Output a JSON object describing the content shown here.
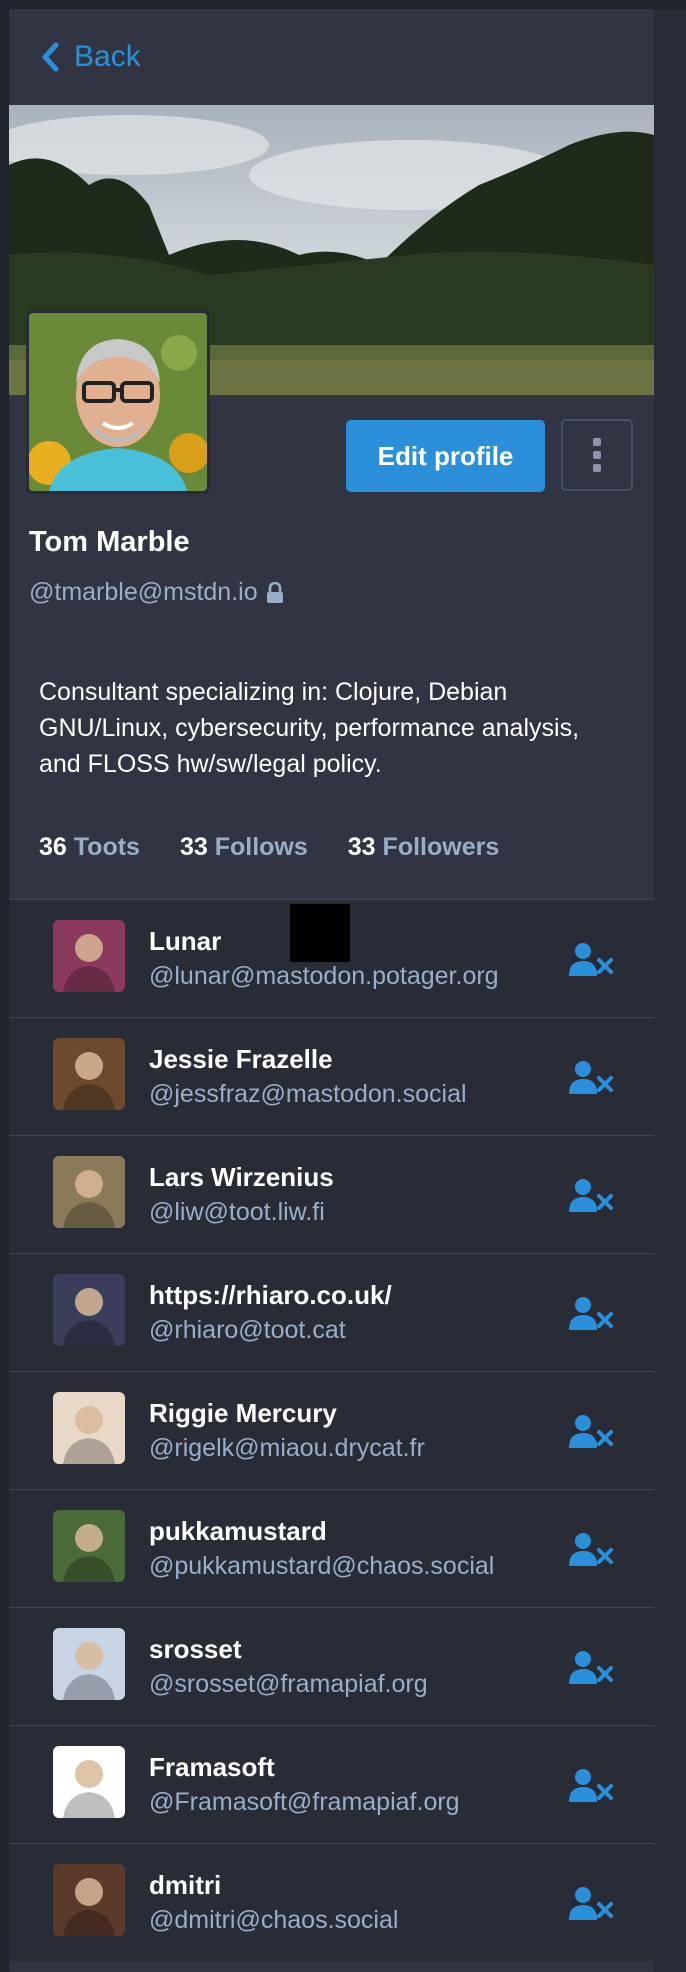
{
  "nav": {
    "back_label": "Back"
  },
  "profile": {
    "display_name": "Tom Marble",
    "acct": "@tmarble@mstdn.io",
    "bio": "Consultant specializing in: Clojure, Debian GNU/Linux, cybersecurity, performance analysis, and FLOSS hw/sw/legal policy.",
    "edit_label": "Edit profile",
    "counts": {
      "toots": {
        "value": "36",
        "label": "Toots"
      },
      "follows": {
        "value": "33",
        "label": "Follows"
      },
      "followers": {
        "value": "33",
        "label": "Followers"
      }
    }
  },
  "following": [
    {
      "name": "Lunar",
      "handle": "@lunar@mastodon.potager.org",
      "avatar": "#8b3a5e"
    },
    {
      "name": "Jessie Frazelle",
      "handle": "@jessfraz@mastodon.social",
      "avatar": "#6b4a2e"
    },
    {
      "name": "Lars Wirzenius",
      "handle": "@liw@toot.liw.fi",
      "avatar": "#8a7a5a"
    },
    {
      "name": "https://rhiaro.co.uk/",
      "handle": "@rhiaro@toot.cat",
      "avatar": "#3a3e5a"
    },
    {
      "name": "Riggie Mercury",
      "handle": "@rigelk@miaou.drycat.fr",
      "avatar": "#e8d8c8"
    },
    {
      "name": "pukkamustard",
      "handle": "@pukkamustard@chaos.social",
      "avatar": "#4a6a3a"
    },
    {
      "name": "srosset",
      "handle": "@srosset@framapiaf.org",
      "avatar": "#c8d4e4"
    },
    {
      "name": "Framasoft",
      "handle": "@Framasoft@framapiaf.org",
      "avatar": "#ffffff"
    },
    {
      "name": "dmitri",
      "handle": "@dmitri@chaos.social",
      "avatar": "#5a3a2a"
    }
  ],
  "colors": {
    "accent": "#2b90d9",
    "muted": "#9baec8",
    "bg": "#282c37"
  }
}
